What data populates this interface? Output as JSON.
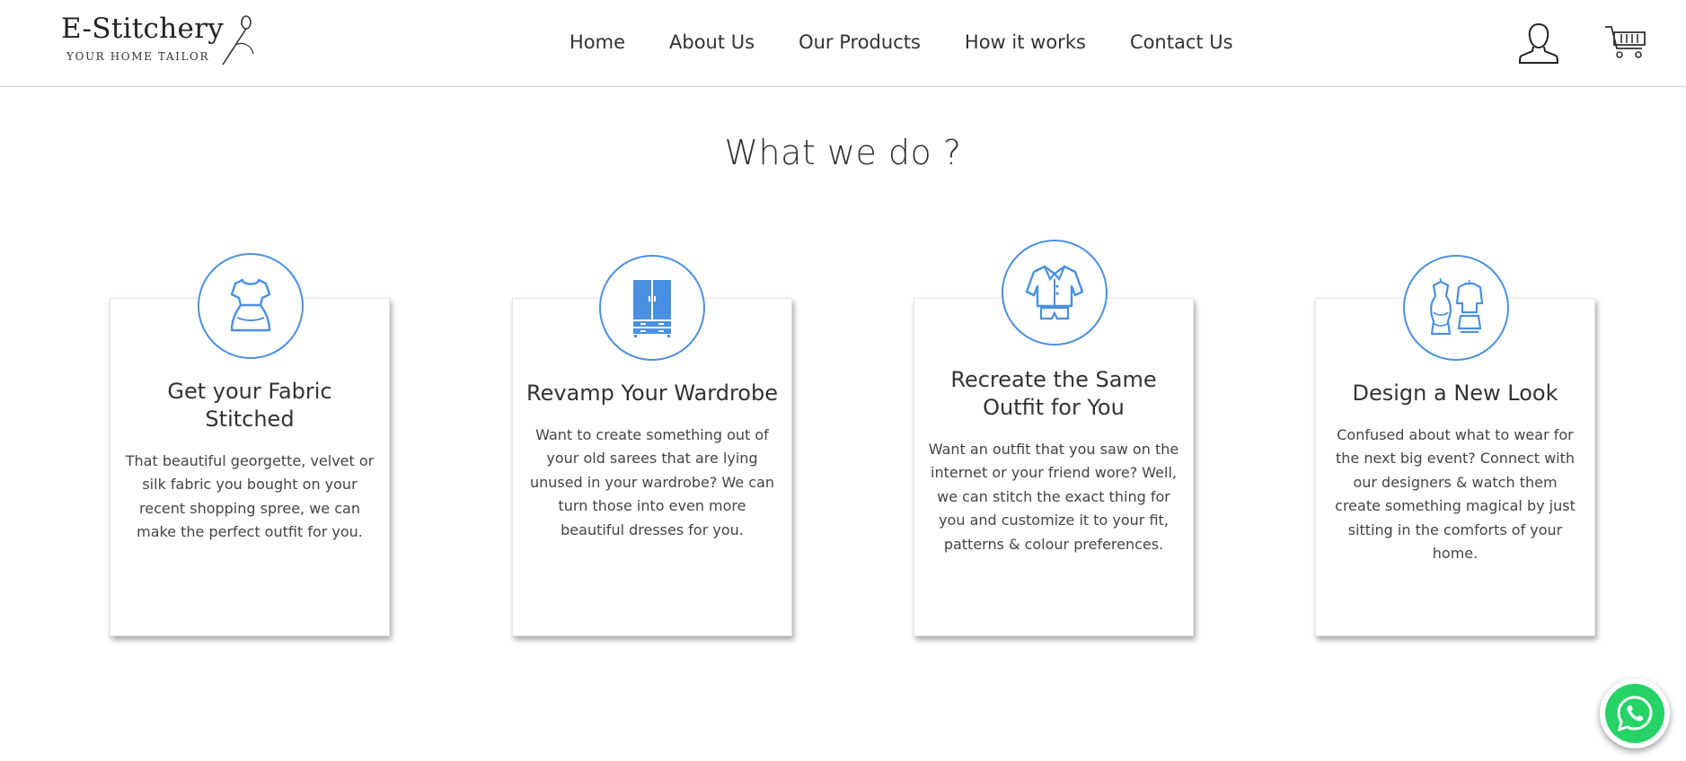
{
  "header": {
    "logo_title": "E-Stitchery",
    "logo_tagline": "YOUR HOME TAILOR",
    "nav": [
      {
        "label": "Home"
      },
      {
        "label": "About Us"
      },
      {
        "label": "Our Products"
      },
      {
        "label": "How it works"
      },
      {
        "label": "Contact Us"
      }
    ],
    "icons": {
      "user": "user-icon",
      "cart": "cart-icon"
    }
  },
  "section": {
    "title": "What we do ?",
    "cards": [
      {
        "icon": "dress-icon",
        "title": "Get your Fabric Stitched",
        "text": "That beautiful georgette, velvet or silk fabric you bought on your recent shopping spree, we can make the perfect outfit for you."
      },
      {
        "icon": "wardrobe-icon",
        "title": "Revamp Your Wardrobe",
        "text": "Want to create something out of your old sarees that are lying unused in your wardrobe? We can turn those into even more beautiful dresses for you."
      },
      {
        "icon": "shirt-icon",
        "title": "Recreate the Same Outfit for You",
        "text": "Want an outfit that you saw on the internet or your friend wore? Well, we can stitch the exact thing for you and customize it to your fit, patterns & colour preferences."
      },
      {
        "icon": "outfits-icon",
        "title": "Design a New Look",
        "text": "Confused about what to wear for the next big event? Connect with our designers & watch them create something magical by just sitting in the comforts of your home."
      }
    ]
  },
  "colors": {
    "accent": "#4a90e2",
    "whatsapp": "#25d366"
  },
  "floating": {
    "icon": "whatsapp-icon"
  }
}
